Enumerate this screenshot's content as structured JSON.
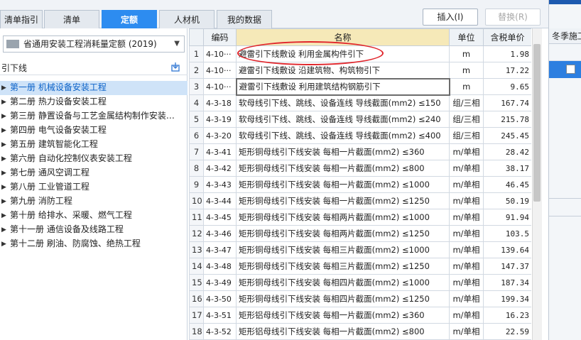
{
  "tabs": [
    {
      "label": "清单指引"
    },
    {
      "label": "清单"
    },
    {
      "label": "定额",
      "active": true
    },
    {
      "label": "人材机"
    },
    {
      "label": "我的数据"
    }
  ],
  "toolbar": {
    "insert_label": "插入(I)",
    "replace_label": "替换(R)"
  },
  "left": {
    "library": "省通用安装工程消耗量定额 (2019)",
    "search_text": "引下线",
    "tree": [
      "第一册 机械设备安装工程",
      "第二册 热力设备安装工程",
      "第三册 静置设备与工艺金属结构制作安装…",
      "第四册 电气设备安装工程",
      "第五册 建筑智能化工程",
      "第六册 自动化控制仪表安装工程",
      "第七册 通风空调工程",
      "第八册 工业管道工程",
      "第九册 消防工程",
      "第十册 给排水、采暖、燃气工程",
      "第十一册 通信设备及线路工程",
      "第十二册 刷油、防腐蚀、绝热工程"
    ]
  },
  "table": {
    "headers": {
      "code": "编码",
      "name": "名称",
      "unit": "单位",
      "price": "含税单价"
    },
    "rows": [
      {
        "n": "1",
        "code": "4-10···",
        "name": "避雷引下线敷设 利用金属构件引下",
        "unit": "m",
        "price": "1.98"
      },
      {
        "n": "2",
        "code": "4-10···",
        "name": "避雷引下线敷设 沿建筑物、构筑物引下",
        "unit": "m",
        "price": "17.22"
      },
      {
        "n": "3",
        "code": "4-10···",
        "name": "避雷引下线敷设 利用建筑结构钢筋引下",
        "unit": "m",
        "price": "9.65"
      },
      {
        "n": "4",
        "code": "4-3-18",
        "name": "软母线引下线、跳线、设备连线 导线截面(mm2) ≤150",
        "unit": "组/三相",
        "price": "167.74"
      },
      {
        "n": "5",
        "code": "4-3-19",
        "name": "软母线引下线、跳线、设备连线 导线截面(mm2) ≤240",
        "unit": "组/三相",
        "price": "215.78"
      },
      {
        "n": "6",
        "code": "4-3-20",
        "name": "软母线引下线、跳线、设备连线 导线截面(mm2) ≤400",
        "unit": "组/三相",
        "price": "245.45"
      },
      {
        "n": "7",
        "code": "4-3-41",
        "name": "矩形铜母线引下线安装 每相一片截面(mm2) ≤360",
        "unit": "m/单相",
        "price": "28.42"
      },
      {
        "n": "8",
        "code": "4-3-42",
        "name": "矩形铜母线引下线安装 每相一片截面(mm2) ≤800",
        "unit": "m/单相",
        "price": "38.17"
      },
      {
        "n": "9",
        "code": "4-3-43",
        "name": "矩形铜母线引下线安装 每相一片截面(mm2) ≤1000",
        "unit": "m/单相",
        "price": "46.45"
      },
      {
        "n": "10",
        "code": "4-3-44",
        "name": "矩形铜母线引下线安装 每相一片截面(mm2) ≤1250",
        "unit": "m/单相",
        "price": "50.19"
      },
      {
        "n": "11",
        "code": "4-3-45",
        "name": "矩形铜母线引下线安装 每相两片截面(mm2) ≤1000",
        "unit": "m/单相",
        "price": "91.94"
      },
      {
        "n": "12",
        "code": "4-3-46",
        "name": "矩形铜母线引下线安装 每相两片截面(mm2) ≤1250",
        "unit": "m/单相",
        "price": "103.5"
      },
      {
        "n": "13",
        "code": "4-3-47",
        "name": "矩形铜母线引下线安装 每相三片截面(mm2) ≤1000",
        "unit": "m/单相",
        "price": "139.64"
      },
      {
        "n": "14",
        "code": "4-3-48",
        "name": "矩形铜母线引下线安装 每相三片截面(mm2) ≤1250",
        "unit": "m/单相",
        "price": "147.37"
      },
      {
        "n": "15",
        "code": "4-3-49",
        "name": "矩形铜母线引下线安装 每相四片截面(mm2) ≤1000",
        "unit": "m/单相",
        "price": "187.34"
      },
      {
        "n": "16",
        "code": "4-3-50",
        "name": "矩形铜母线引下线安装 每相四片截面(mm2) ≤1250",
        "unit": "m/单相",
        "price": "199.34"
      },
      {
        "n": "17",
        "code": "4-3-51",
        "name": "矩形铝母线引下线安装 每相一片截面(mm2) ≤360",
        "unit": "m/单相",
        "price": "16.23"
      },
      {
        "n": "18",
        "code": "4-3-52",
        "name": "矩形铝母线引下线安装 每相一片截面(mm2) ≤800",
        "unit": "m/单相",
        "price": "22.59"
      }
    ]
  },
  "right": {
    "header": "冬季施工"
  },
  "colors": {
    "accent": "#2d8cf0",
    "annotation": "#e0252b",
    "name_header": "#f6e9b8"
  }
}
